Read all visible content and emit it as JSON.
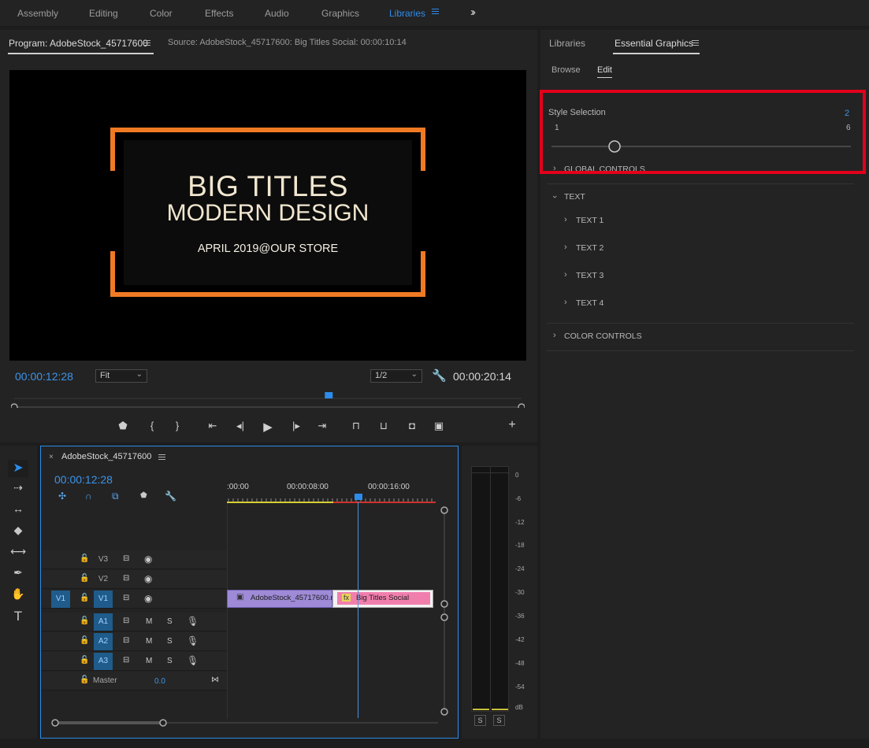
{
  "workspaces": {
    "tabs": [
      "Assembly",
      "Editing",
      "Color",
      "Effects",
      "Audio",
      "Graphics",
      "Libraries"
    ],
    "active": "Libraries",
    "more_icon": "double-chevron-right-icon"
  },
  "program": {
    "tab_label": "Program: AdobeStock_45717600",
    "source_label": "Source: AdobeStock_45717600: Big Titles Social: 00:00:10:14",
    "video": {
      "line1": "BIG TITLES",
      "line2": "MODERN DESIGN",
      "line3": "APRIL 2019@OUR STORE",
      "frame_color": "#f07a24"
    },
    "current_timecode": "00:00:12:28",
    "fit_select": "Fit",
    "resolution_select": "1/2",
    "duration_timecode": "00:00:20:14",
    "playhead_fraction": 0.62
  },
  "essential_graphics": {
    "tabs": [
      "Libraries",
      "Essential Graphics"
    ],
    "active_tab": "Essential Graphics",
    "subtabs": [
      "Browse",
      "Edit"
    ],
    "active_subtab": "Edit",
    "style_selection": {
      "label": "Style Selection",
      "value": "2",
      "min": "1",
      "max": "6",
      "level_fraction": 0.2
    },
    "global_controls": "GLOBAL CONTROLS",
    "text_section": "TEXT",
    "text_items": [
      "TEXT 1",
      "TEXT 2",
      "TEXT 3",
      "TEXT 4"
    ],
    "color_controls": "COLOR CONTROLS",
    "highlight_color": "#e3001b"
  },
  "timeline": {
    "sequence_name": "AdobeStock_45717600",
    "timecode": "00:00:12:28",
    "ruler": [
      ":00:00",
      "00:00:08:00",
      "00:00:16:00"
    ],
    "video_tracks": [
      {
        "name": "V3",
        "source": ""
      },
      {
        "name": "V2",
        "source": ""
      },
      {
        "name": "V1",
        "source": "V1"
      }
    ],
    "audio_tracks": [
      {
        "name": "A1",
        "m": "M",
        "s": "S"
      },
      {
        "name": "A2",
        "m": "M",
        "s": "S"
      },
      {
        "name": "A3",
        "m": "M",
        "s": "S"
      }
    ],
    "master": {
      "label": "Master",
      "value": "0.0"
    },
    "clips": [
      {
        "label": "AdobeStock_45717600.m",
        "color": "#9e8ad6"
      },
      {
        "label": "Big Titles Social",
        "color": "#f17fae",
        "fx": "fx"
      }
    ]
  },
  "audio_meter": {
    "db_labels": [
      "0",
      "-6",
      "-12",
      "-18",
      "-24",
      "-30",
      "-36",
      "-42",
      "-48",
      "-54",
      "dB"
    ],
    "solo_labels": [
      "S",
      "S"
    ]
  }
}
